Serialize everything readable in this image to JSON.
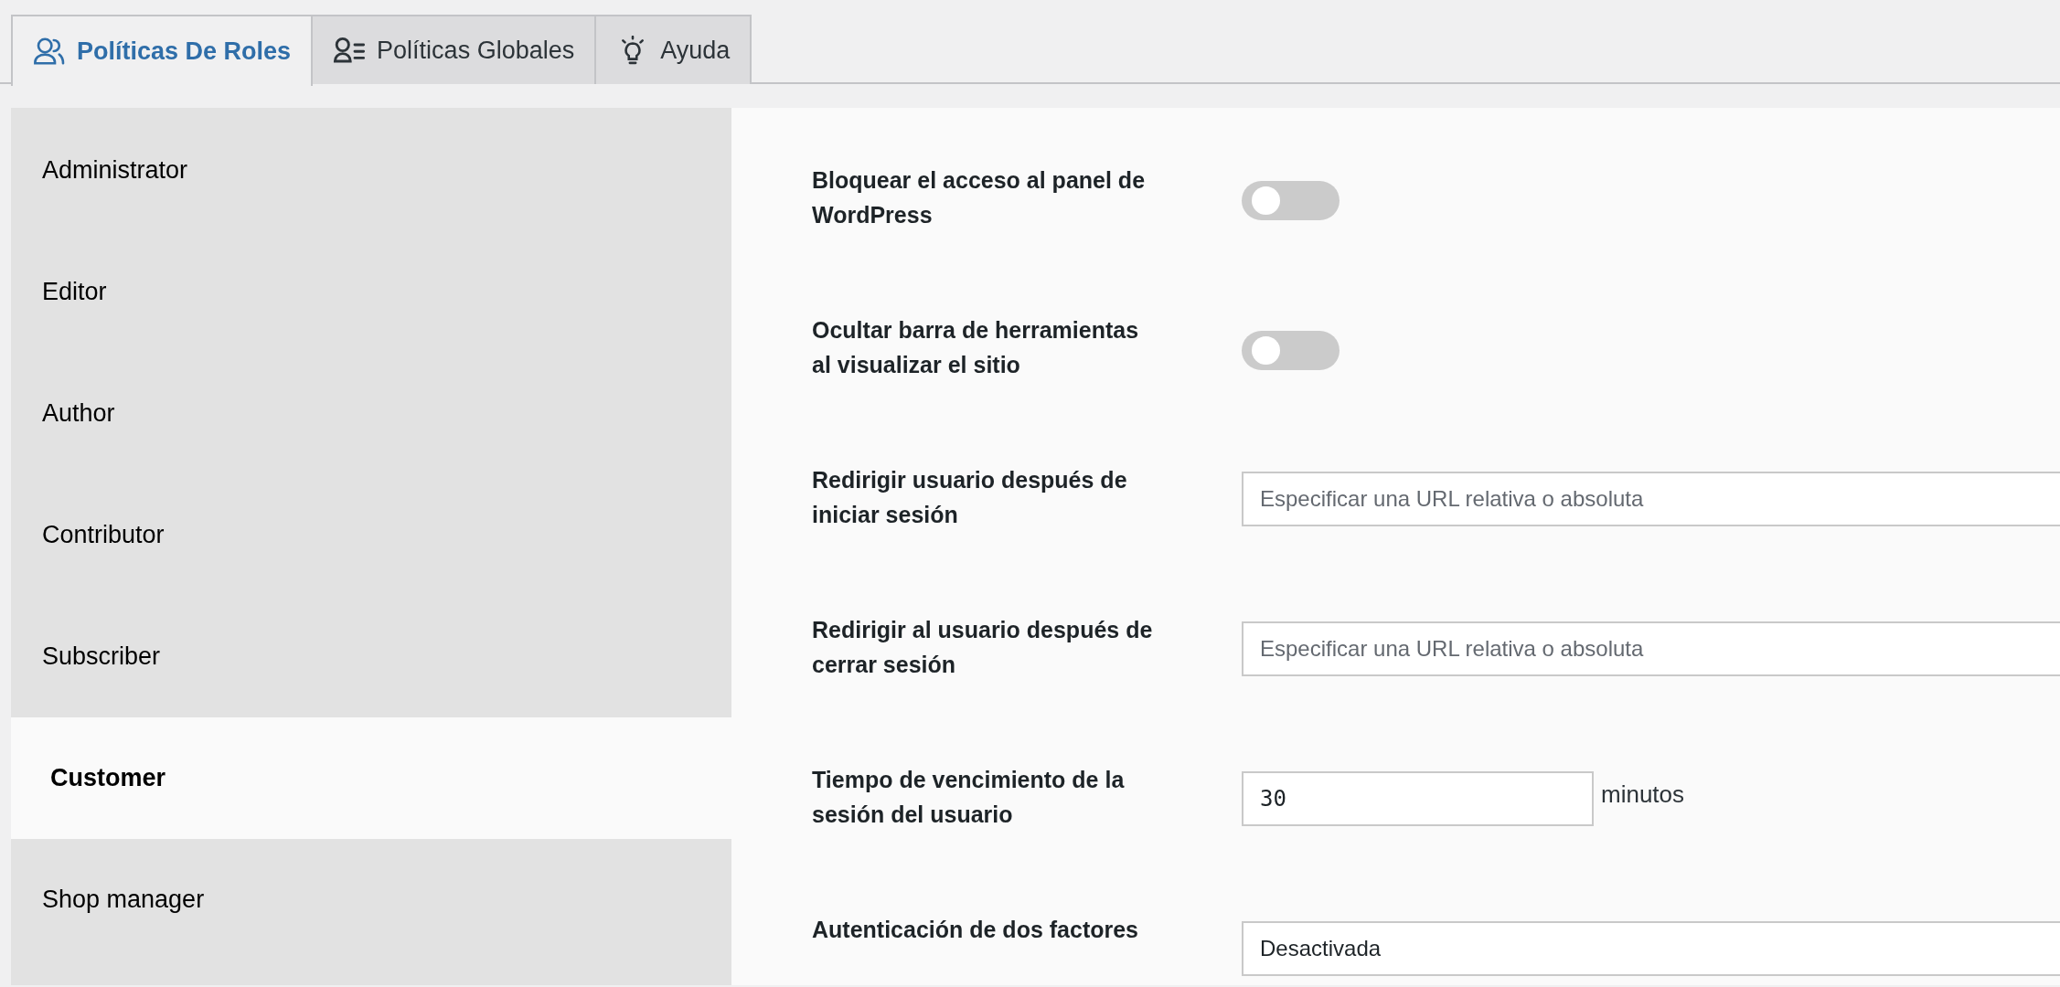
{
  "tabs": [
    {
      "label": "Políticas De Roles",
      "kind": "users",
      "selected": true
    },
    {
      "label": "Políticas Globales",
      "kind": "user-list",
      "selected": false
    },
    {
      "label": "Ayuda",
      "kind": "bulb",
      "selected": false
    }
  ],
  "sidebar": {
    "items": [
      {
        "label": "Administrator",
        "selected": false
      },
      {
        "label": "Editor",
        "selected": false
      },
      {
        "label": "Author",
        "selected": false
      },
      {
        "label": "Contributor",
        "selected": false
      },
      {
        "label": "Subscriber",
        "selected": false
      },
      {
        "label": "Customer",
        "selected": true
      },
      {
        "label": "Shop manager",
        "selected": false
      }
    ]
  },
  "settings": [
    {
      "kind": "toggle",
      "label": "Bloquear el acceso al panel de WordPress",
      "on": false
    },
    {
      "kind": "toggle",
      "label": "Ocultar barra de herramientas al visualizar el sitio",
      "on": false
    },
    {
      "kind": "text",
      "label": "Redirigir usuario después de iniciar sesión",
      "placeholder": "Especificar una URL relativa o absoluta"
    },
    {
      "kind": "text",
      "label": "Redirigir al usuario después de cerrar sesión",
      "placeholder": "Especificar una URL relativa o absoluta"
    },
    {
      "kind": "number",
      "label": "Tiempo de vencimiento de la sesión del usuario",
      "value": "30",
      "unit": "minutos"
    },
    {
      "kind": "select",
      "label": "Autenticación de dos factores",
      "value": "Desactivada"
    }
  ]
}
